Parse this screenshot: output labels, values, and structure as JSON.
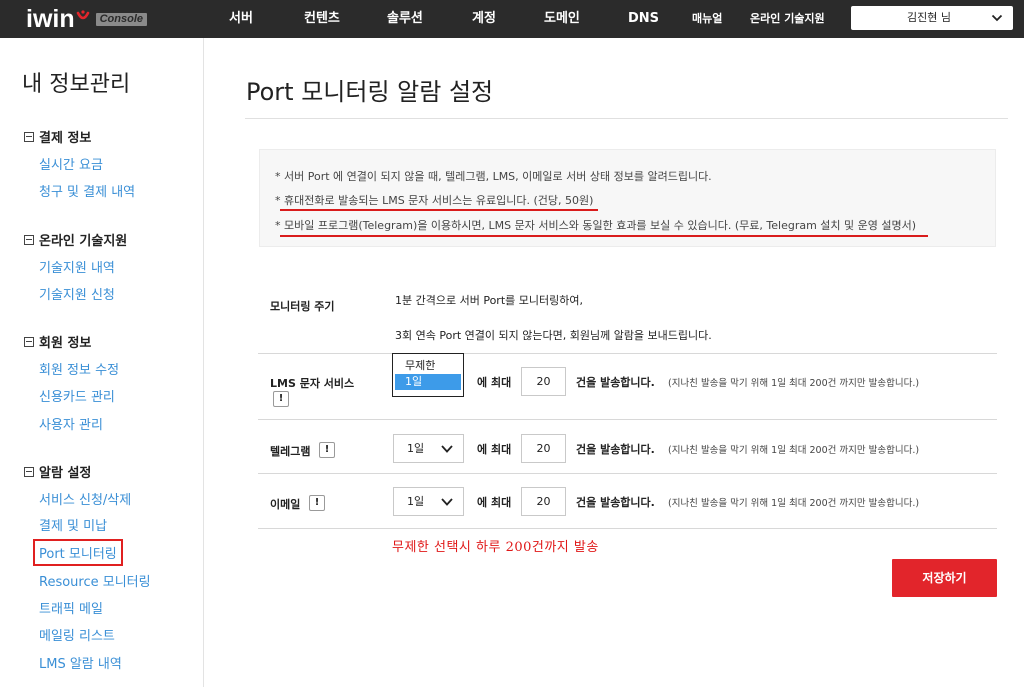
{
  "header": {
    "logo_text": "iwin",
    "logo_badge": "Console",
    "nav": [
      "서버",
      "컨텐츠",
      "솔루션",
      "계정",
      "도메인",
      "DNS",
      "매뉴얼",
      "온라인 기술지원"
    ],
    "user": "김진현 님"
  },
  "sidebar": {
    "title": "내 정보관리",
    "sections": [
      {
        "label": "결제 정보",
        "items": [
          "실시간 요금",
          "청구 및 결제 내역"
        ]
      },
      {
        "label": "온라인 기술지원",
        "items": [
          "기술지원 내역",
          "기술지원 신청"
        ]
      },
      {
        "label": "회원 정보",
        "items": [
          "회원 정보 수정",
          "신용카드 관리",
          "사용자 관리"
        ]
      },
      {
        "label": "알람 설정",
        "items": [
          "서비스 신청/삭제",
          "결제 및 미납",
          "Port 모니터링",
          "Resource 모니터링",
          "트래픽 메일",
          "메일링 리스트",
          "LMS 알람 내역"
        ]
      }
    ],
    "active_item": "Port 모니터링"
  },
  "main": {
    "title": "Port 모니터링 알람 설정",
    "notices": [
      "* 서버 Port 에 연결이 되지 않을 때, 텔레그램, LMS, 이메일로 서버 상태 정보를 알려드립니다.",
      "* 휴대전화로 발송되는 LMS 문자 서비스는 유료입니다. (건당, 50원)",
      "* 모바일 프로그램(Telegram)을 이용하시면, LMS 문자 서비스와 동일한 효과를 보실 수 있습니다. (무료, Telegram 설치 및 운영 설명서)"
    ],
    "monitor": {
      "label": "모니터링 주기",
      "line1": "1분 간격으로 서버 Port를 모니터링하여,",
      "line2": "3회 연속 Port 연결이 되지 않는다면, 회원님께 알람을 보내드립니다."
    },
    "rows": [
      {
        "label": "LMS 문자 서비스",
        "select": "1일",
        "max_label": "에 최대",
        "count": "20",
        "suffix": "건을 발송합니다.",
        "hint": "(지나친 발송을 막기 위해 1일 최대 200건 까지만 발송합니다.)"
      },
      {
        "label": "텔레그램",
        "select": "1일",
        "max_label": "에 최대",
        "count": "20",
        "suffix": "건을 발송합니다.",
        "hint": "(지나친 발송을 막기 위해 1일 최대 200건 까지만 발송합니다.)"
      },
      {
        "label": "이메일",
        "select": "1일",
        "max_label": "에 최대",
        "count": "20",
        "suffix": "건을 발송합니다.",
        "hint": "(지나친 발송을 막기 위해 1일 최대 200건 까지만 발송합니다.)"
      }
    ],
    "dropdown_options": [
      "무제한",
      "1일"
    ],
    "dropdown_selected": "1일",
    "info_icon": "!",
    "warning": "무제한 선택시 하루 200건까지 발송",
    "save_label": "저장하기"
  },
  "colors": {
    "accent": "#e2252b",
    "link": "#3a8fd6",
    "topbar": "#2b2b2b",
    "highlight": "#d91c1c"
  }
}
